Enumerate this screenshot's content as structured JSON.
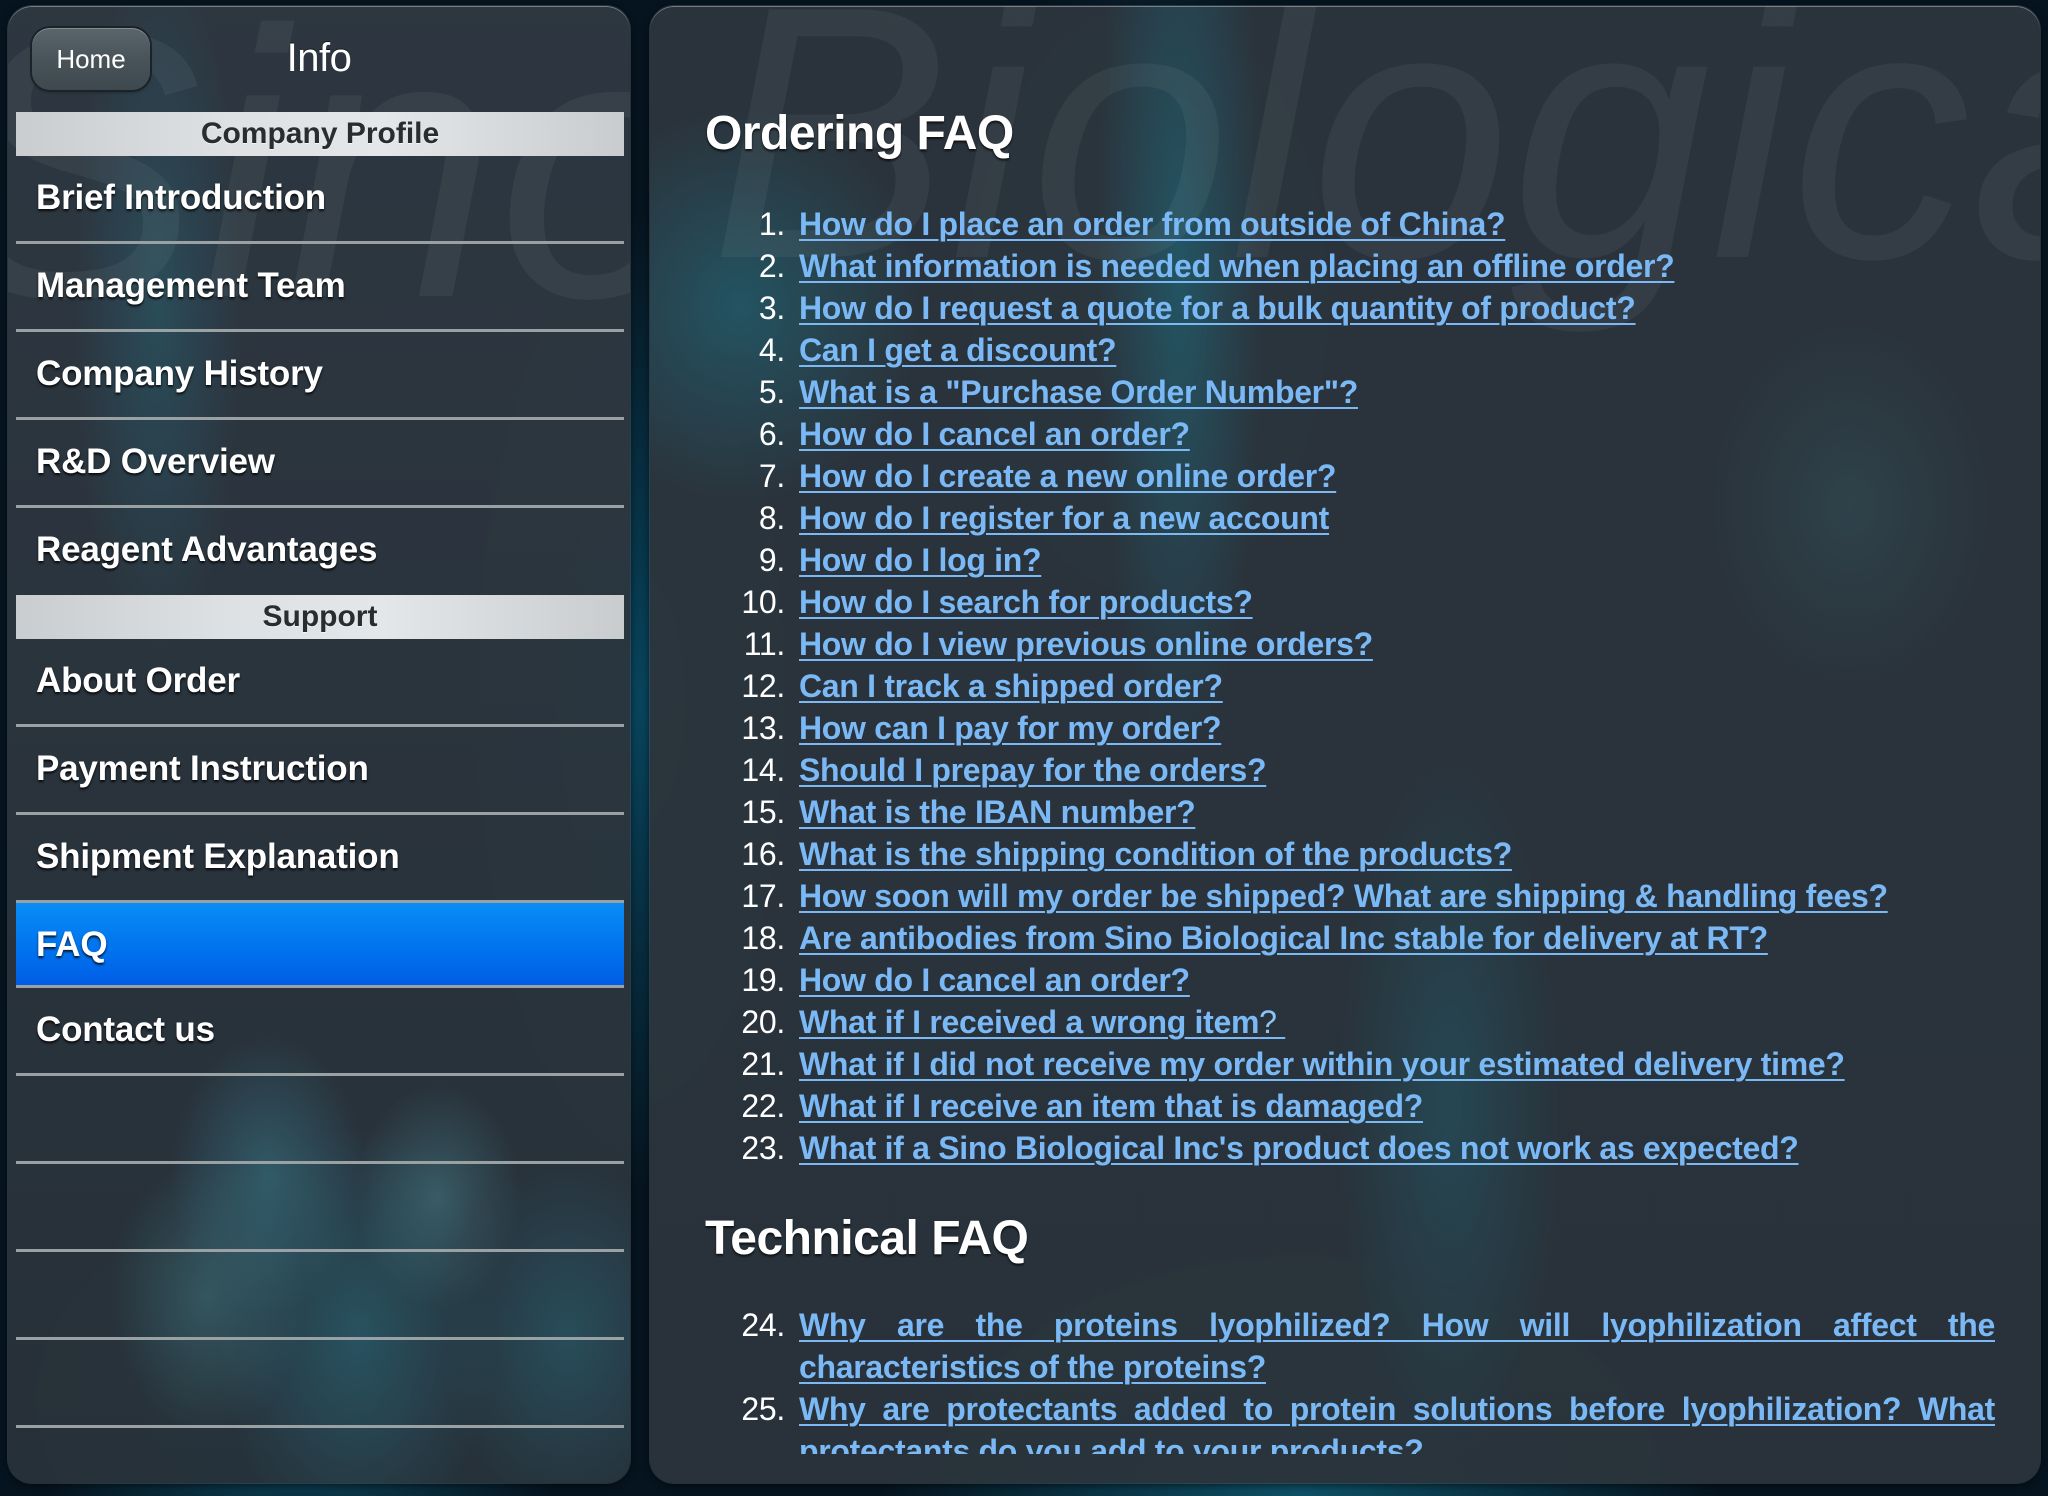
{
  "sidebar": {
    "watermark": "Sino",
    "home_button": "Home",
    "title": "Info",
    "sections": [
      {
        "header": "Company Profile",
        "items": [
          {
            "label": "Brief Introduction"
          },
          {
            "label": "Management Team"
          },
          {
            "label": "Company History"
          },
          {
            "label": "R&D Overview"
          },
          {
            "label": "Reagent Advantages"
          }
        ]
      },
      {
        "header": "Support",
        "items": [
          {
            "label": "About Order"
          },
          {
            "label": "Payment Instruction"
          },
          {
            "label": "Shipment Explanation"
          },
          {
            "label": "FAQ",
            "selected": true
          },
          {
            "label": "Contact us"
          }
        ]
      }
    ],
    "selected_color": "#0074ee"
  },
  "main": {
    "watermark": "Biological",
    "ordering": {
      "heading": "Ordering FAQ",
      "items": [
        {
          "num": "1.",
          "text": "How do I place an order from outside of China?"
        },
        {
          "num": "2.",
          "text": "What information is needed when placing an offline order?"
        },
        {
          "num": "3.",
          "text": "How do I request a quote for a bulk quantity of product?"
        },
        {
          "num": "4.",
          "text": "Can I get a discount?"
        },
        {
          "num": "5.",
          "text": "What is a \"Purchase Order Number\"?"
        },
        {
          "num": "6.",
          "text": "How do I cancel an order?"
        },
        {
          "num": "7.",
          "text": "How do I create a new online order?"
        },
        {
          "num": "8.",
          "text": "How do I register for a new account"
        },
        {
          "num": "9.",
          "text": "How do I log in?"
        },
        {
          "num": "10.",
          "text": "How do I search for products?"
        },
        {
          "num": "11.",
          "text": "How do I view previous online orders?"
        },
        {
          "num": "12.",
          "text": "Can I track a shipped order?"
        },
        {
          "num": "13.",
          "text": "How can I pay for my order?"
        },
        {
          "num": "14.",
          "text": "Should I prepay for the orders?"
        },
        {
          "num": "15.",
          "text": "What is the IBAN number?"
        },
        {
          "num": "16.",
          "text": "What is the shipping condition of the products?"
        },
        {
          "num": "17.",
          "text": "How soon will my order be shipped? What are shipping & handling fees?"
        },
        {
          "num": "18.",
          "text": "Are antibodies from Sino Biological Inc stable for delivery at RT?"
        },
        {
          "num": "19.",
          "text": "How do I cancel an order?"
        },
        {
          "num": "20.",
          "text": "What if I received a wrong item",
          "suffix": "? "
        },
        {
          "num": "21.",
          "text": "What if I did not receive my order within your estimated delivery time?"
        },
        {
          "num": "22.",
          "text": "What if I receive an item that is damaged?"
        },
        {
          "num": "23.",
          "text": "What if a Sino Biological Inc's product does not work as expected?"
        }
      ]
    },
    "technical": {
      "heading": "Technical FAQ",
      "items": [
        {
          "num": "24.",
          "text": "Why are the proteins lyophilized? How will lyophilization affect the characteristics of the proteins?"
        },
        {
          "num": "25.",
          "text": "Why are protectants added to protein solutions before lyophilization? What protectants do you add to your products?"
        }
      ]
    },
    "link_color": "#7ab9f6"
  }
}
